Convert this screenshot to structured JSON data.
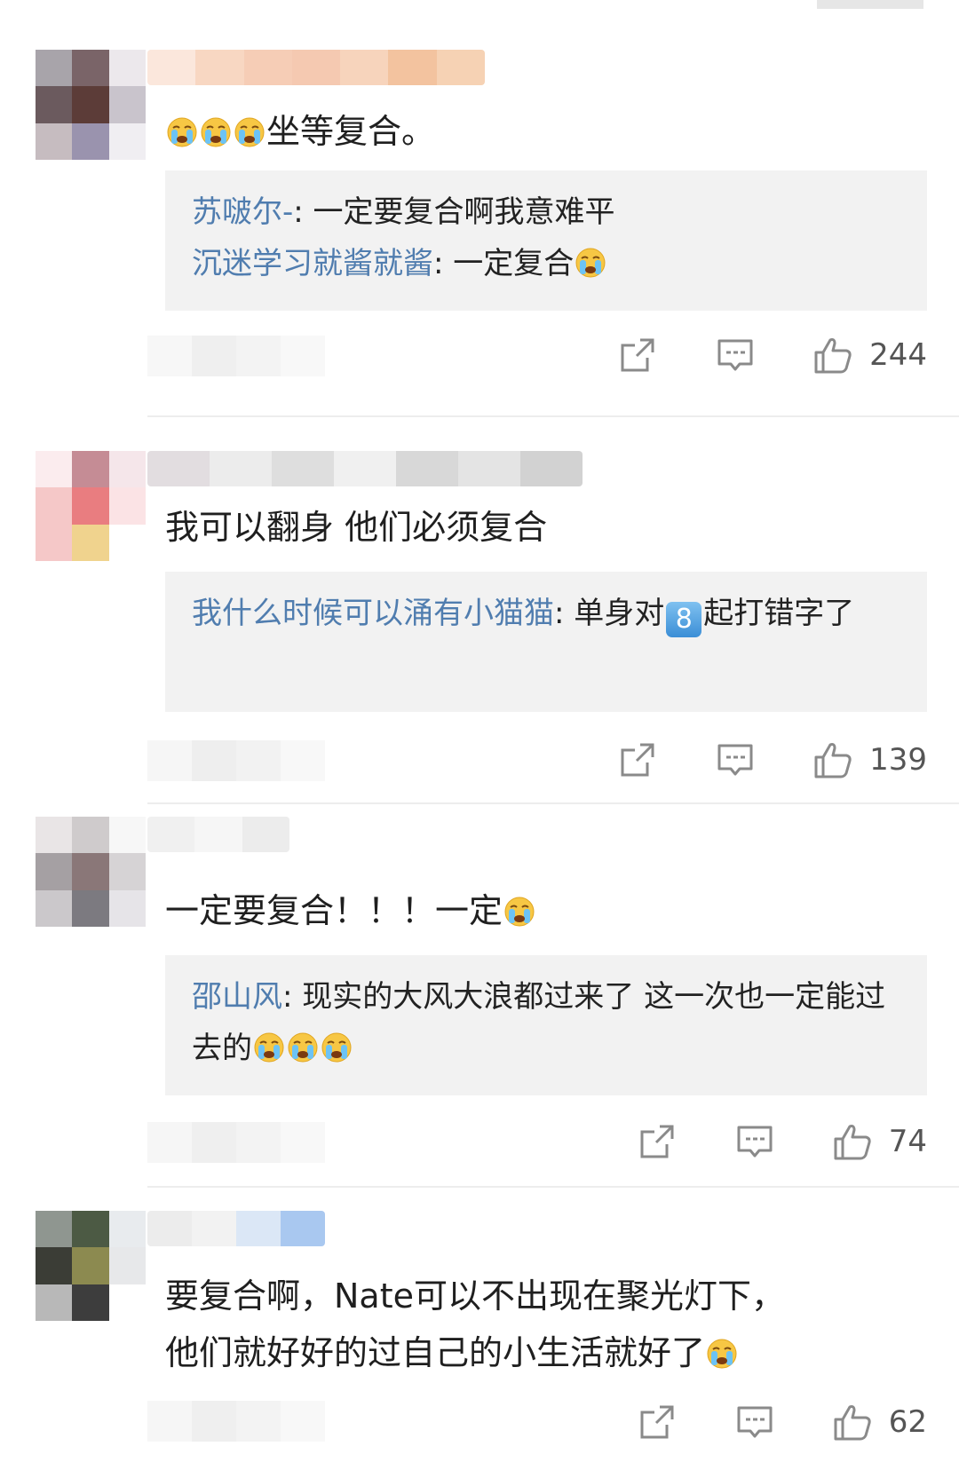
{
  "comments": [
    {
      "text": "坐等复合。",
      "text_prefix_emoji_count": 3,
      "replies": [
        {
          "user": "苏啵尔-",
          "sep": ": ",
          "text": "一定要复合啊我意难平",
          "emoji_after": 0
        },
        {
          "user": "沉迷学习就酱就酱",
          "sep": ": ",
          "text": "一定复合",
          "emoji_after": 1
        }
      ],
      "likes": "244"
    },
    {
      "text": "我可以翻身 他们必须复合",
      "replies": [
        {
          "user": "我什么时候可以涌有小猫猫",
          "sep": ": ",
          "text_a": "单身对",
          "badge": "8",
          "text_b": "起打错字了"
        }
      ],
      "likes": "139"
    },
    {
      "text": "一定要复合！！！一定",
      "text_suffix_emoji_count": 1,
      "replies": [
        {
          "user": "邵山风",
          "sep": ": ",
          "text": "现实的大风大浪都过来了 这一次也一定能过去的",
          "emoji_after": 3
        }
      ],
      "likes": "74"
    },
    {
      "text_line1": "要复合啊，Nate可以不出现在聚光灯下，",
      "text_line2": "他们就好好的过自己的小生活就好了",
      "text_suffix_emoji_count": 1,
      "likes": "62"
    }
  ],
  "icons": {
    "share": "share-icon",
    "comment": "comment-icon",
    "like": "thumbs-up-icon",
    "emoji": "crying-face-icon"
  },
  "colors": {
    "reply_user": "#507daf",
    "reply_bg": "#f2f2f2",
    "icon_stroke": "#8a8a8a"
  }
}
